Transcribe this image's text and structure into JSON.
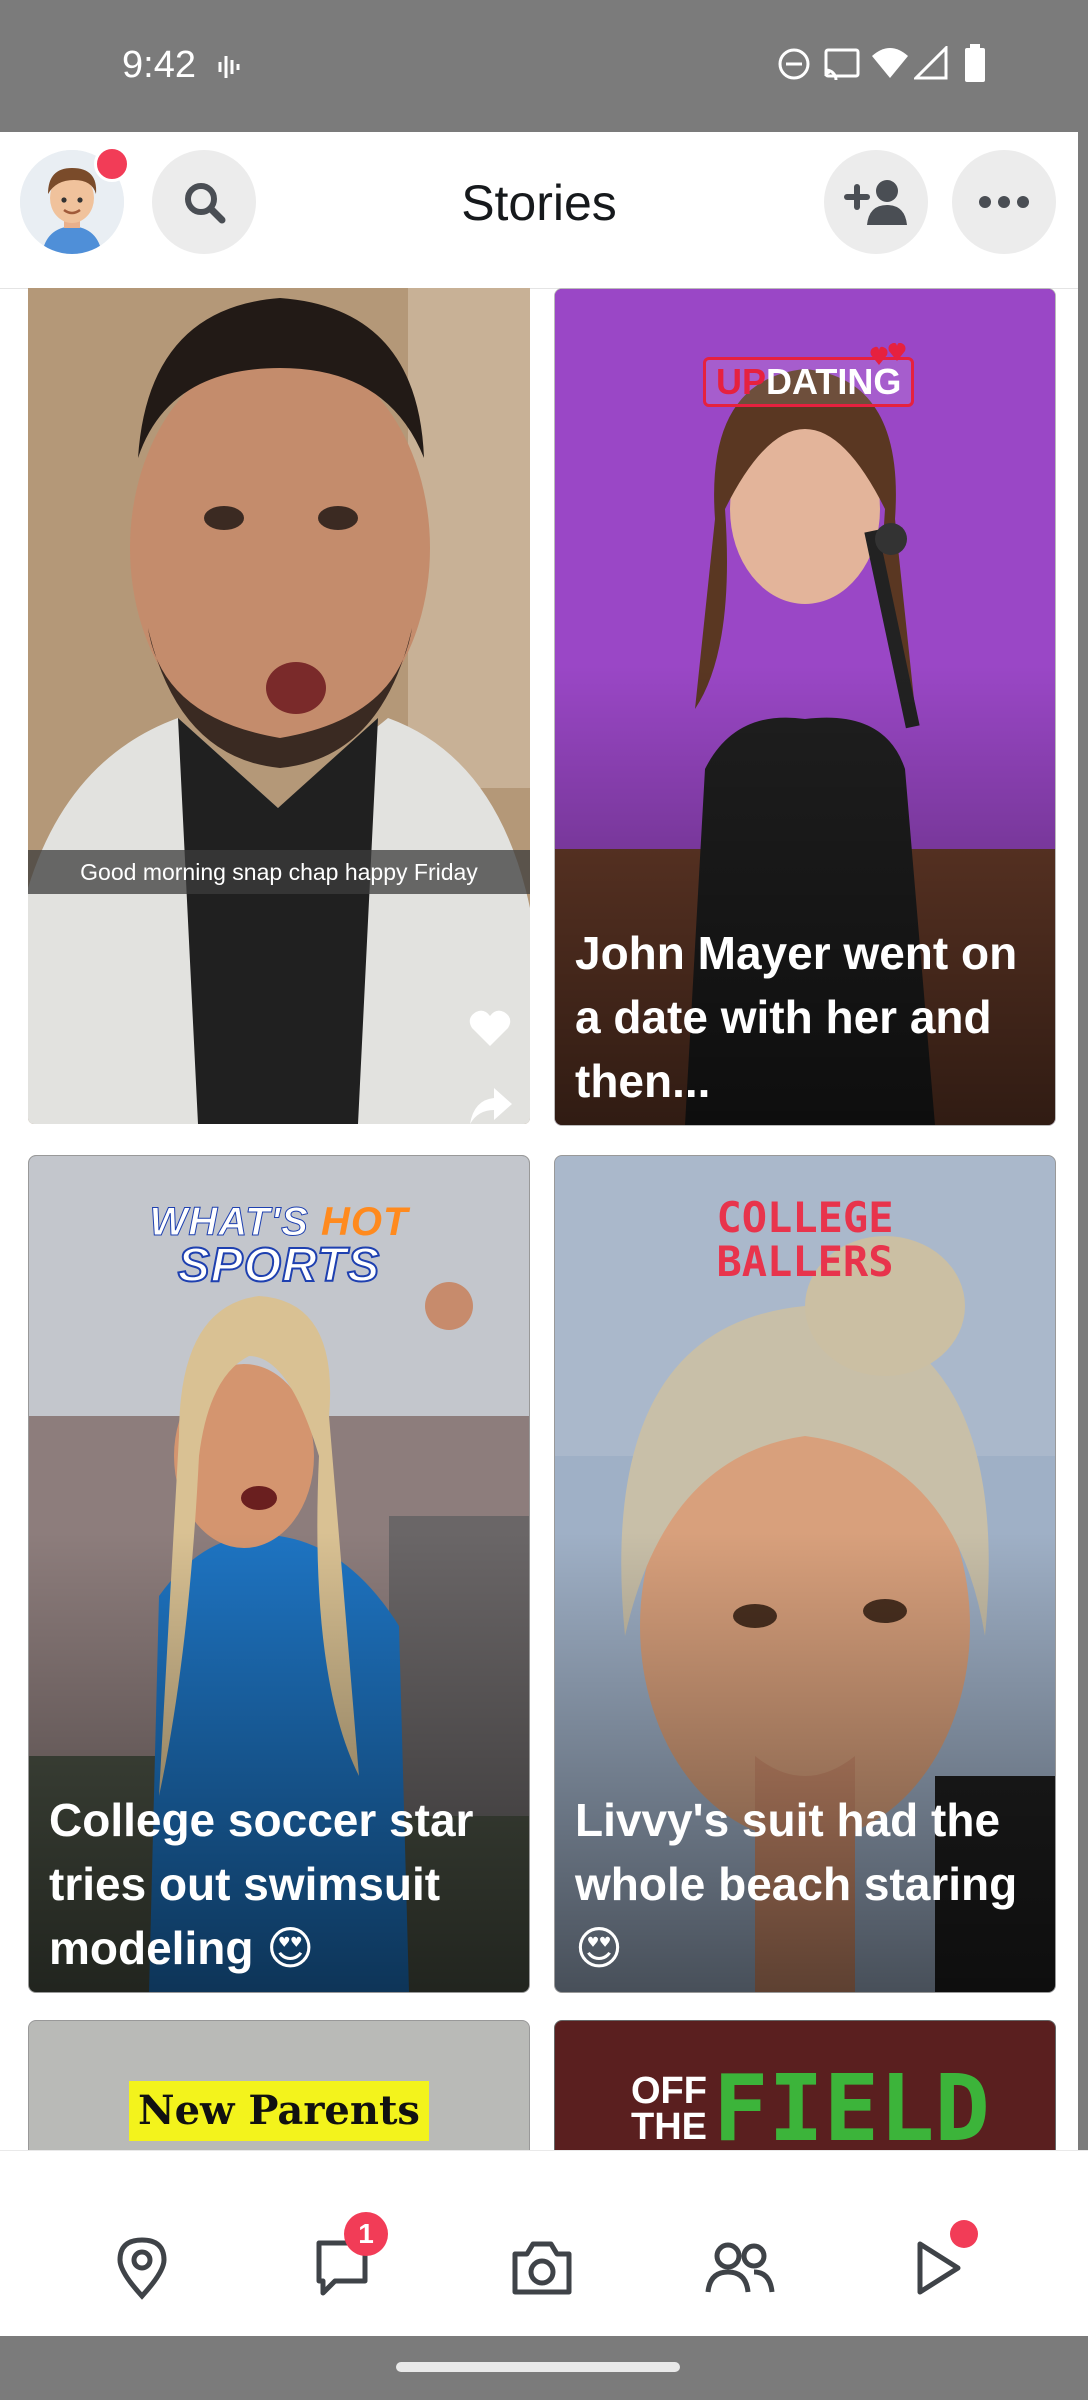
{
  "status_bar": {
    "time": "9:42",
    "icons": [
      "voicemail-icon",
      "dnd-icon",
      "cast-icon",
      "wifi-icon",
      "signal-icon",
      "battery-icon"
    ]
  },
  "header": {
    "title": "Stories",
    "avatar_has_notification": true,
    "buttons": [
      "search-icon",
      "add-friend-icon",
      "more-icon"
    ]
  },
  "cards": [
    {
      "id": "snap-story",
      "caption_overlay": "Good morning snap chap happy Friday",
      "actions": [
        "heart-icon",
        "share-icon"
      ]
    },
    {
      "id": "updating",
      "logo": "UPDATING",
      "logo_prefix": "UP",
      "logo_rest": "DATING",
      "caption": "John Mayer went on a date with her and then..."
    },
    {
      "id": "whats-hot-sports",
      "logo_line1_a": "WHAT'S",
      "logo_line1_b": "HOT",
      "logo_line2": "SPORTS",
      "caption": "College soccer star tries out swimsuit modeling 😍"
    },
    {
      "id": "college-ballers",
      "logo_line1": "COLLEGE",
      "logo_line2": "BALLERS",
      "caption": "Livvy's suit had the whole beach staring 😍"
    },
    {
      "id": "new-parents",
      "logo": "New Parents"
    },
    {
      "id": "off-the-field",
      "logo_a": "OFF",
      "logo_b": "THE",
      "logo_c": "FIELD"
    }
  ],
  "bottom_nav": {
    "items": [
      "map-icon",
      "chat-icon",
      "camera-icon",
      "friends-icon",
      "spotlight-icon"
    ],
    "chat_badge": "1",
    "spotlight_dot": true
  },
  "colors": {
    "accent_red": "#f23c57",
    "status_bar_gray": "#7b7b7b"
  }
}
